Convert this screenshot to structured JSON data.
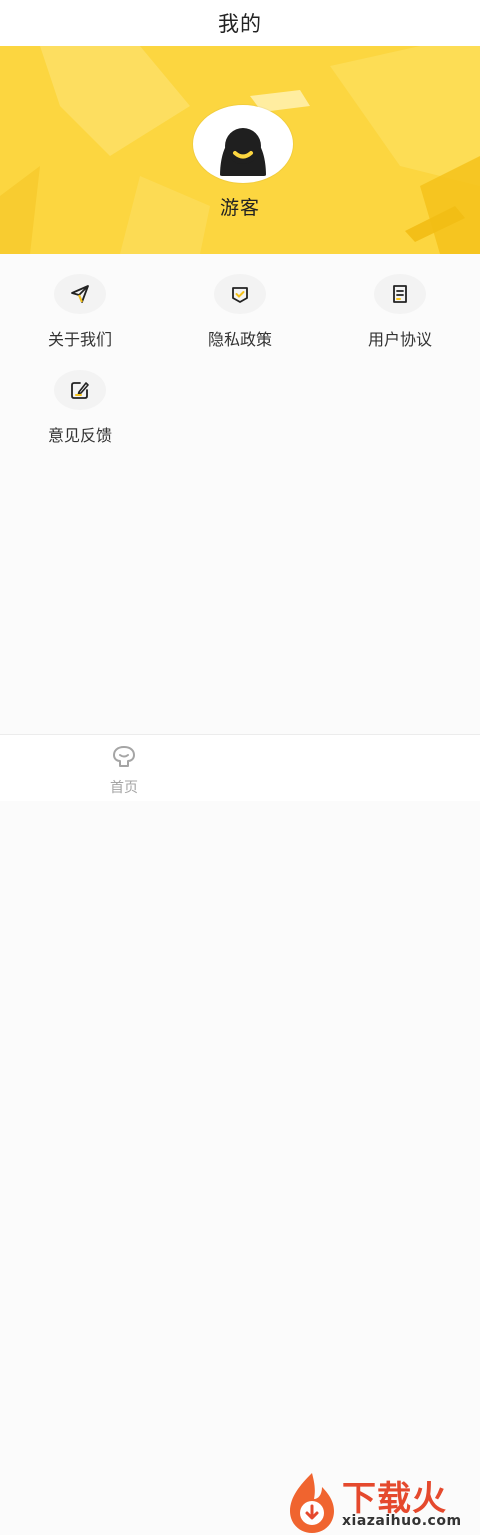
{
  "header": {
    "title": "我的"
  },
  "profile": {
    "username": "游客",
    "avatar_icon": "user-avatar-icon"
  },
  "menu": {
    "items": [
      {
        "label": "关于我们",
        "icon": "send-icon"
      },
      {
        "label": "隐私政策",
        "icon": "shield-check-icon"
      },
      {
        "label": "用户协议",
        "icon": "document-icon"
      },
      {
        "label": "意见反馈",
        "icon": "edit-icon"
      }
    ]
  },
  "tabbar": {
    "home_label": "首页",
    "home_icon": "home-icon"
  },
  "watermark": {
    "brand": "下载火",
    "url": "xiazaihuo.com"
  },
  "colors": {
    "accent": "#fcd640",
    "accent_dark": "#f5c21b",
    "brand_red": "#e5492d"
  }
}
